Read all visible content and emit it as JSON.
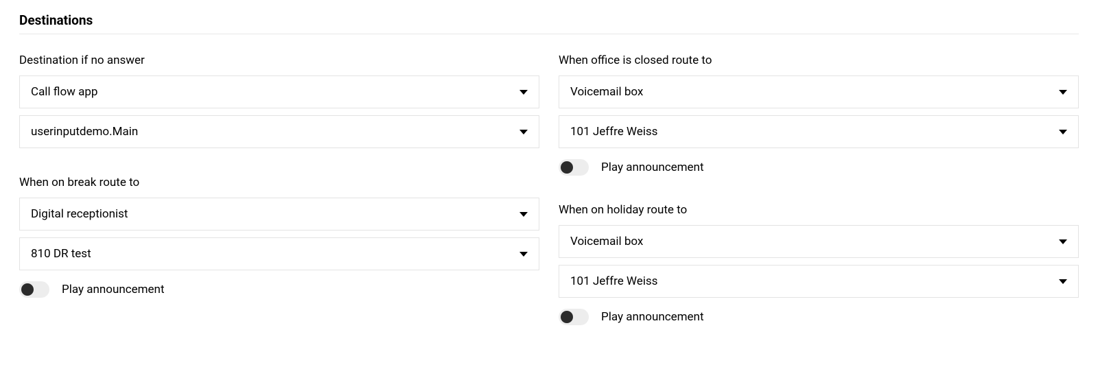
{
  "section_title": "Destinations",
  "no_answer": {
    "label": "Destination if no answer",
    "type_value": "Call flow app",
    "target_value": "userinputdemo.Main"
  },
  "office_closed": {
    "label": "When office is closed route to",
    "type_value": "Voicemail box",
    "target_value": "101 Jeffre Weiss",
    "toggle_label": "Play announcement",
    "toggle_on": false
  },
  "on_break": {
    "label": "When on break route to",
    "type_value": "Digital receptionist",
    "target_value": "810 DR test",
    "toggle_label": "Play announcement",
    "toggle_on": false
  },
  "on_holiday": {
    "label": "When on holiday route to",
    "type_value": "Voicemail box",
    "target_value": "101 Jeffre Weiss",
    "toggle_label": "Play announcement",
    "toggle_on": false
  }
}
